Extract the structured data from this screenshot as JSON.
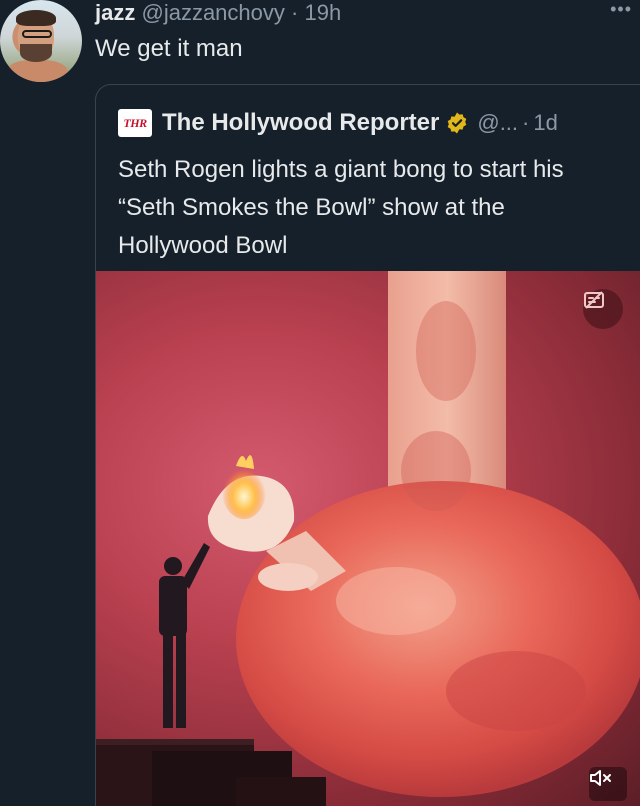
{
  "tweet": {
    "author_name": "jazz",
    "author_handle": "@jazzanchovy",
    "separator": "·",
    "time": "19h",
    "text": "We get it man",
    "more_icon": "more-horizontal-icon"
  },
  "quoted_tweet": {
    "logo_text": "THR",
    "author_name": "The Hollywood Reporter",
    "author_handle": "@...",
    "separator": "·",
    "time": "1d",
    "verified_icon": "verified-badge-icon",
    "text": "Seth Rogen lights a giant bong to start his “Seth Smokes the Bowl” show at the Hollywood Bowl",
    "media": {
      "type": "video",
      "top_badge_icon": "media-settings-icon",
      "mute_icon": "volume-muted-icon"
    }
  },
  "colors": {
    "background": "#15202b",
    "text": "#e7e9ea",
    "muted": "#8b98a5",
    "border": "#38444d",
    "verified_gold": "#e2b719",
    "thr_red": "#c8102e"
  }
}
